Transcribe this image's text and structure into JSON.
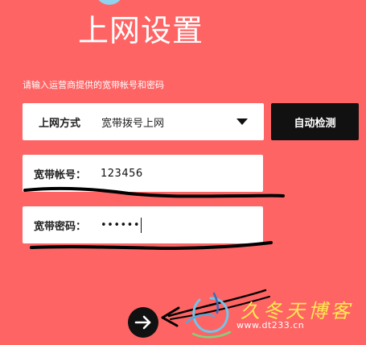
{
  "header": {
    "title": "上网设置"
  },
  "instruction": "请输入运营商提供的宽带帐号和密码",
  "connection_type": {
    "label": "上网方式",
    "selected": "宽带拨号上网"
  },
  "auto_detect_label": "自动检测",
  "account": {
    "label": "宽带帐号：",
    "value": "123456"
  },
  "password": {
    "label": "宽带密码：",
    "masked_value": "••••••"
  },
  "watermark": {
    "text": "久冬天博客",
    "url": "www.dt233.cn"
  },
  "colors": {
    "background": "#ff6464",
    "button": "#111111",
    "field": "#ffffff",
    "watermark": "#ffe94f"
  }
}
